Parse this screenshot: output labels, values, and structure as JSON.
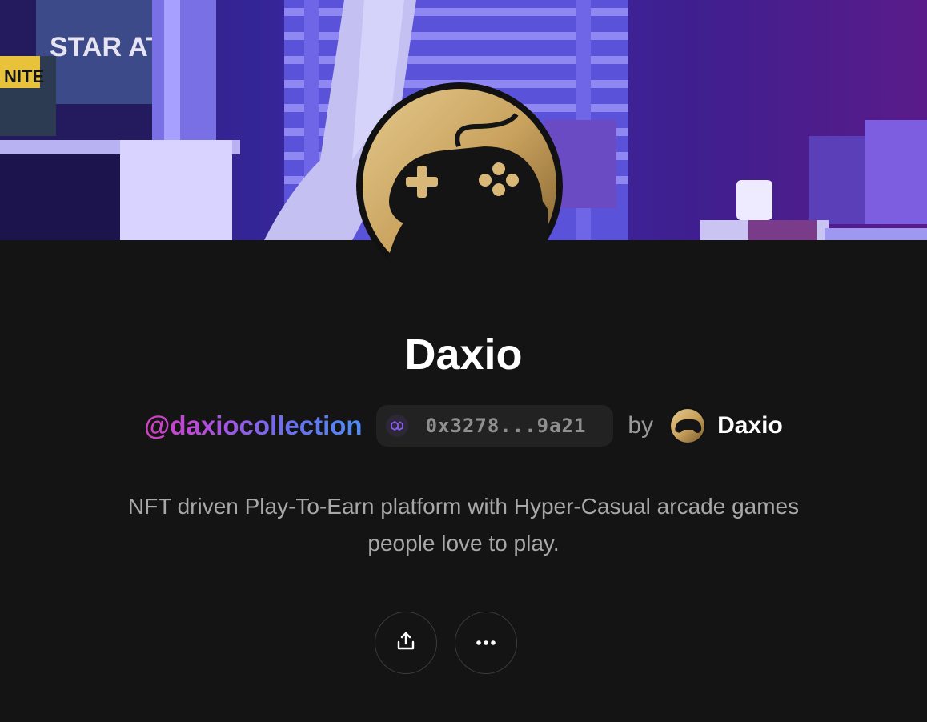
{
  "collection": {
    "title": "Daxio",
    "handle": "@daxiocollection",
    "address": "0x3278...9a21",
    "chain_icon": "polygon-icon",
    "by_label": "by",
    "creator_name": "Daxio",
    "description": "NFT driven Play-To-Earn platform with Hyper-Casual arcade games people love to play.",
    "banner_text": {
      "line1": "STAR ATL",
      "line2": "NITE"
    }
  },
  "actions": {
    "share_icon": "share-icon",
    "more_icon": "more-dots-icon"
  },
  "colors": {
    "background": "#141414",
    "handle_gradient_start": "#d23fc0",
    "handle_gradient_end": "#4f8cf2",
    "gold": "#c9a25e"
  }
}
